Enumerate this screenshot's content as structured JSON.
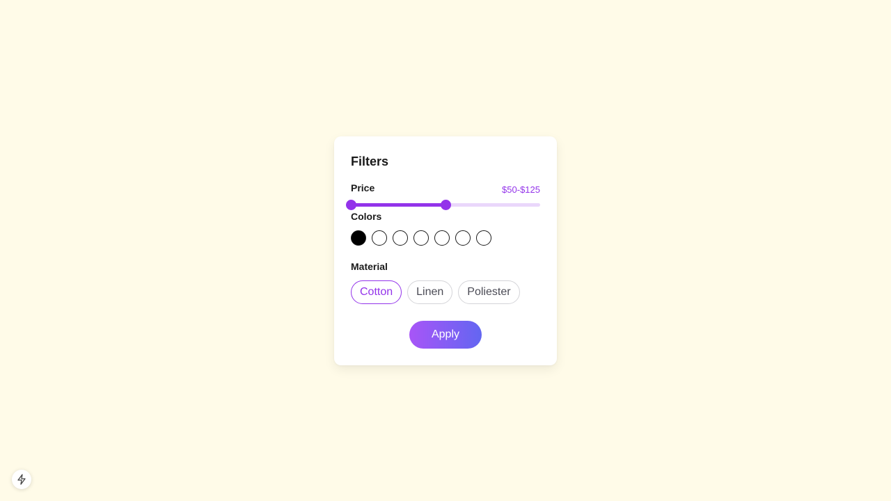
{
  "filters": {
    "title": "Filters",
    "price": {
      "label": "Price",
      "value_text": "$50-$125",
      "range_min": 0,
      "range_max": 250,
      "selected_low": 0,
      "selected_high": 125
    },
    "colors": {
      "label": "Colors",
      "swatches": [
        {
          "name": "black",
          "hex": "#000000",
          "selected": true
        },
        {
          "name": "option-2",
          "hex": "#ffffff",
          "selected": false
        },
        {
          "name": "option-3",
          "hex": "#ffffff",
          "selected": false
        },
        {
          "name": "option-4",
          "hex": "#ffffff",
          "selected": false
        },
        {
          "name": "option-5",
          "hex": "#ffffff",
          "selected": false
        },
        {
          "name": "option-6",
          "hex": "#ffffff",
          "selected": false
        },
        {
          "name": "option-7",
          "hex": "#ffffff",
          "selected": false
        }
      ]
    },
    "material": {
      "label": "Material",
      "options": [
        {
          "label": "Cotton",
          "selected": true
        },
        {
          "label": "Linen",
          "selected": false
        },
        {
          "label": "Poliester",
          "selected": false
        }
      ]
    },
    "apply_label": "Apply"
  },
  "theme": {
    "accent": "#9333ea",
    "gradient_start": "#a855f7",
    "gradient_end": "#6366f1",
    "background": "#fffbe8"
  },
  "corner_button": {
    "icon": "bolt-icon"
  }
}
